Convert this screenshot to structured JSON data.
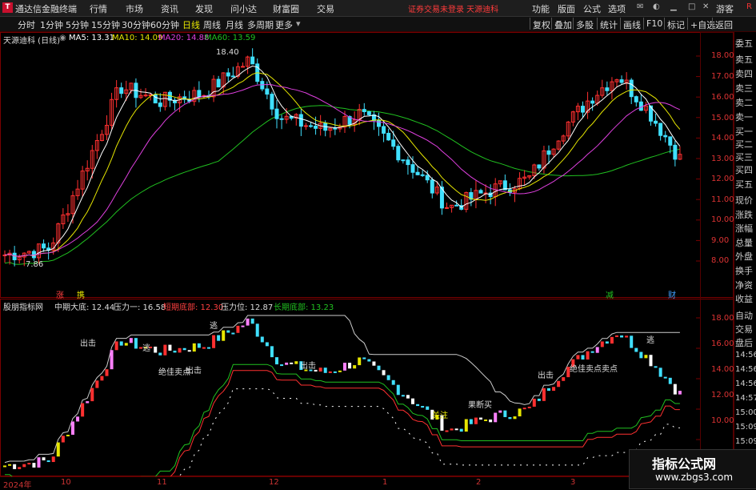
{
  "titlebar": {
    "app_title": "通达信金融终端",
    "menus": [
      "行情",
      "市场",
      "资讯",
      "发现",
      "问小达",
      "财富圈",
      "交易"
    ],
    "warning": "证券交易未登录 天源迪科",
    "right_menus": [
      "功能",
      "版面",
      "公式",
      "选项"
    ],
    "guest": "游客"
  },
  "toolbar": {
    "periods": [
      "分时",
      "1分钟",
      "5分钟",
      "15分钟",
      "30分钟",
      "60分钟",
      "日线",
      "周线",
      "月线",
      "多周期",
      "更多"
    ],
    "active_period": "日线",
    "right_buttons": [
      "复权",
      "叠加",
      "多股",
      "统计",
      "画线",
      "F10",
      "标记",
      "+自选",
      "返回"
    ]
  },
  "main_chart": {
    "title": "天源迪科 (日线)",
    "ma5_label": "MA5: 13.31",
    "ma10_label": "MA10: 14.09",
    "ma20_label": "MA20: 14.88",
    "ma60_label": "MA60: 13.59",
    "colors": {
      "ma5": "#ffffff",
      "ma10": "#e6e600",
      "ma20": "#e040e0",
      "ma60": "#20c020",
      "up": "#ff3030",
      "down": "#40e0ff"
    },
    "high_marker": "18.40",
    "low_marker": "7.86",
    "price_ticks": [
      "18.00",
      "17.00",
      "16.00",
      "15.00",
      "14.00",
      "13.00",
      "12.00",
      "11.00",
      "10.00",
      "9.00",
      "8.00"
    ],
    "event_tags": [
      "涨",
      "携",
      "减",
      "财"
    ]
  },
  "indicator_chart": {
    "name": "股朋指标网",
    "mid_low": "中期大底: 12.44",
    "pressure1": "压力一: 16.58",
    "short_bottom": "短期底部: 12.30",
    "pressure_level": "压力位: 12.87",
    "long_bottom": "长期底部: 13.23",
    "ticks": [
      "18.00",
      "16.00",
      "14.00",
      "12.00",
      "10.00"
    ],
    "annotations": [
      "逃",
      "绝佳卖点",
      "出击",
      "逃",
      "出击",
      "出击",
      "关注",
      "果断买",
      "出击",
      "绝佳卖点",
      "卖点",
      "逃"
    ]
  },
  "side_panel": {
    "items": [
      "委五",
      "卖五",
      "卖四",
      "卖三",
      "卖二",
      "卖一",
      "买一",
      "买二",
      "买三",
      "买四",
      "买五",
      "现价",
      "涨跌",
      "涨幅",
      "总量",
      "外盘",
      "换手",
      "净资",
      "收益"
    ],
    "lower_items": [
      "自动",
      "交易",
      "盘后",
      "14:56",
      "14:56",
      "14:56",
      "14:57",
      "15:00",
      "15:09",
      "15:09"
    ]
  },
  "time_axis": {
    "labels": [
      "2024年",
      "10",
      "11",
      "12",
      "1",
      "2",
      "3"
    ]
  },
  "watermark": {
    "title": "指标公式网",
    "url": "www.zbgs3.com"
  }
}
